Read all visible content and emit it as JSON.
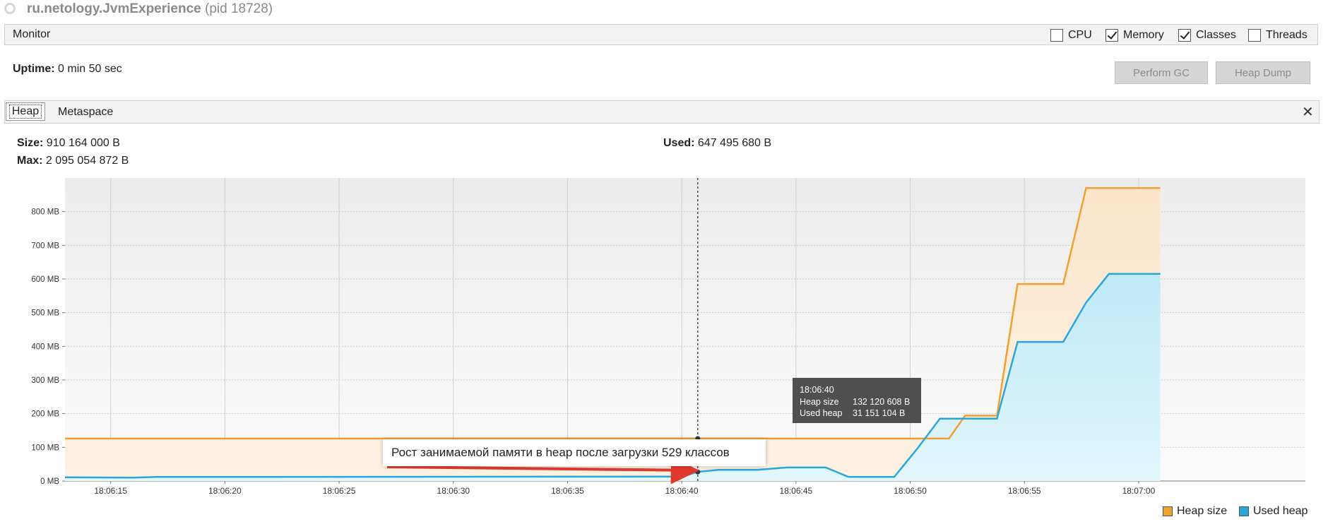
{
  "header": {
    "app_name": "ru.netology.JvmExperience",
    "pid": "(pid 18728)"
  },
  "monitor": {
    "label": "Monitor",
    "checkboxes": [
      {
        "label": "CPU",
        "checked": false
      },
      {
        "label": "Memory",
        "checked": true
      },
      {
        "label": "Classes",
        "checked": true
      },
      {
        "label": "Threads",
        "checked": false
      }
    ]
  },
  "uptime": {
    "label": "Uptime:",
    "value": "0 min 50 sec"
  },
  "buttons": {
    "perform_gc": "Perform GC",
    "heap_dump": "Heap Dump"
  },
  "tabs": {
    "heap": "Heap",
    "metaspace": "Metaspace",
    "close_icon": "close-icon"
  },
  "stats": {
    "size_label": "Size:",
    "size_value": "910 164 000 B",
    "max_label": "Max:",
    "max_value": "2 095 054 872 B",
    "used_label": "Used:",
    "used_value": "647 495 680 B"
  },
  "tooltip": {
    "time": "18:06:40",
    "heap_size_label": "Heap size",
    "heap_size_value": "132 120 608 B",
    "used_heap_label": "Used heap",
    "used_heap_value": "31 151 104 B"
  },
  "annotation": {
    "text": "Рост занимаемой памяти в heap после загрузки 529 классов"
  },
  "colors": {
    "heap_size": "#f0a030",
    "heap_size_fill": "#fbe6cc",
    "used_heap": "#2aa6d8",
    "used_heap_fill": "#bfe9f7",
    "arrow": "#e03a2f"
  },
  "chart_data": {
    "type": "area",
    "y_unit": "MB",
    "ylim": [
      0,
      900
    ],
    "y_ticks": [
      {
        "value": 0,
        "label": "0 MB"
      },
      {
        "value": 100,
        "label": "100 MB"
      },
      {
        "value": 200,
        "label": "200 MB"
      },
      {
        "value": 300,
        "label": "300 MB"
      },
      {
        "value": 400,
        "label": "400 MB"
      },
      {
        "value": 500,
        "label": "500 MB"
      },
      {
        "value": 600,
        "label": "600 MB"
      },
      {
        "value": 700,
        "label": "700 MB"
      },
      {
        "value": 800,
        "label": "800 MB"
      }
    ],
    "x_range_sec": [
      13,
      67.3
    ],
    "x_ticks": [
      {
        "value": 15,
        "label": "18:06:15"
      },
      {
        "value": 20,
        "label": "18:06:20"
      },
      {
        "value": 25,
        "label": "18:06:25"
      },
      {
        "value": 30,
        "label": "18:06:30"
      },
      {
        "value": 35,
        "label": "18:06:35"
      },
      {
        "value": 40,
        "label": "18:06:40"
      },
      {
        "value": 45,
        "label": "18:06:45"
      },
      {
        "value": 50,
        "label": "18:06:50"
      },
      {
        "value": 55,
        "label": "18:06:55"
      },
      {
        "value": 60,
        "label": "18:07:00"
      }
    ],
    "cursor_x": 40.7,
    "series": [
      {
        "name": "Heap size",
        "legend_label": "Heap size",
        "points": [
          [
            13,
            126
          ],
          [
            40.7,
            126
          ],
          [
            51.7,
            126
          ],
          [
            52.4,
            194
          ],
          [
            53.8,
            194
          ],
          [
            54.7,
            585
          ],
          [
            56.7,
            585
          ],
          [
            57.7,
            870
          ],
          [
            60.95,
            870
          ]
        ]
      },
      {
        "name": "Used heap",
        "legend_label": "Used heap",
        "points": [
          [
            13,
            11
          ],
          [
            16,
            10
          ],
          [
            17,
            12
          ],
          [
            40,
            13
          ],
          [
            40.7,
            27
          ],
          [
            41.6,
            33
          ],
          [
            43.3,
            33
          ],
          [
            44.6,
            40
          ],
          [
            46.3,
            40
          ],
          [
            47.3,
            12
          ],
          [
            49.3,
            12
          ],
          [
            50.3,
            95
          ],
          [
            51.3,
            185
          ],
          [
            53.8,
            185
          ],
          [
            54.7,
            413
          ],
          [
            56.7,
            413
          ],
          [
            57.7,
            530
          ],
          [
            58.7,
            615
          ],
          [
            60.95,
            615
          ]
        ]
      }
    ]
  }
}
